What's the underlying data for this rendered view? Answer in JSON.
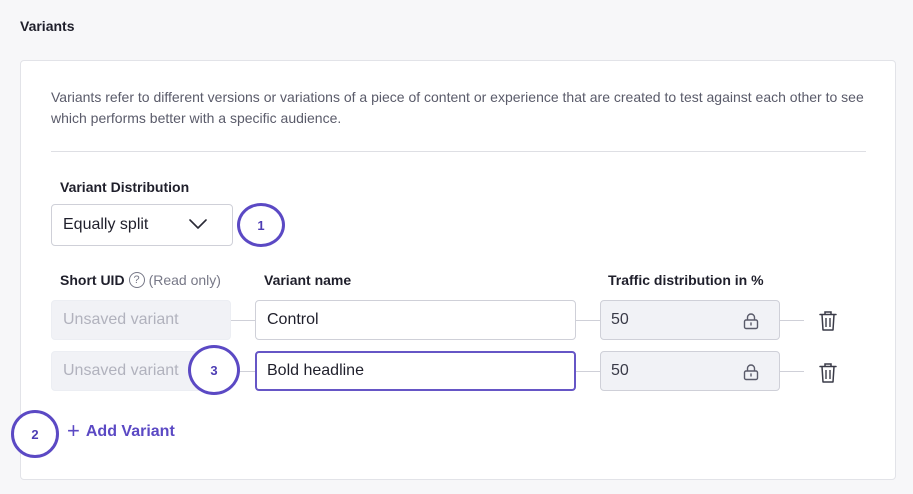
{
  "section": {
    "title": "Variants"
  },
  "description": "Variants refer to different versions or variations of a piece of content or experience that are created to test against each other to see which performs better with a specific audience.",
  "distribution": {
    "label": "Variant Distribution",
    "selected": "Equally split"
  },
  "columns": {
    "uid": "Short UID",
    "uid_note": "(Read only)",
    "name": "Variant name",
    "traffic": "Traffic distribution in %"
  },
  "variants": [
    {
      "uid": "Unsaved variant",
      "name": "Control",
      "traffic": "50"
    },
    {
      "uid": "Unsaved variant",
      "name": "Bold headline",
      "traffic": "50"
    }
  ],
  "add_variant_label": "Add Variant",
  "annotations": {
    "one": "1",
    "two": "2",
    "three": "3"
  },
  "icons": {
    "select": "chevron-down-icon",
    "help": "question-circle-icon",
    "lock": "lock-icon",
    "delete": "trash-icon",
    "add": "plus-icon"
  },
  "colors": {
    "accent": "#5b49c4",
    "badge_border": "#5b49c4"
  }
}
